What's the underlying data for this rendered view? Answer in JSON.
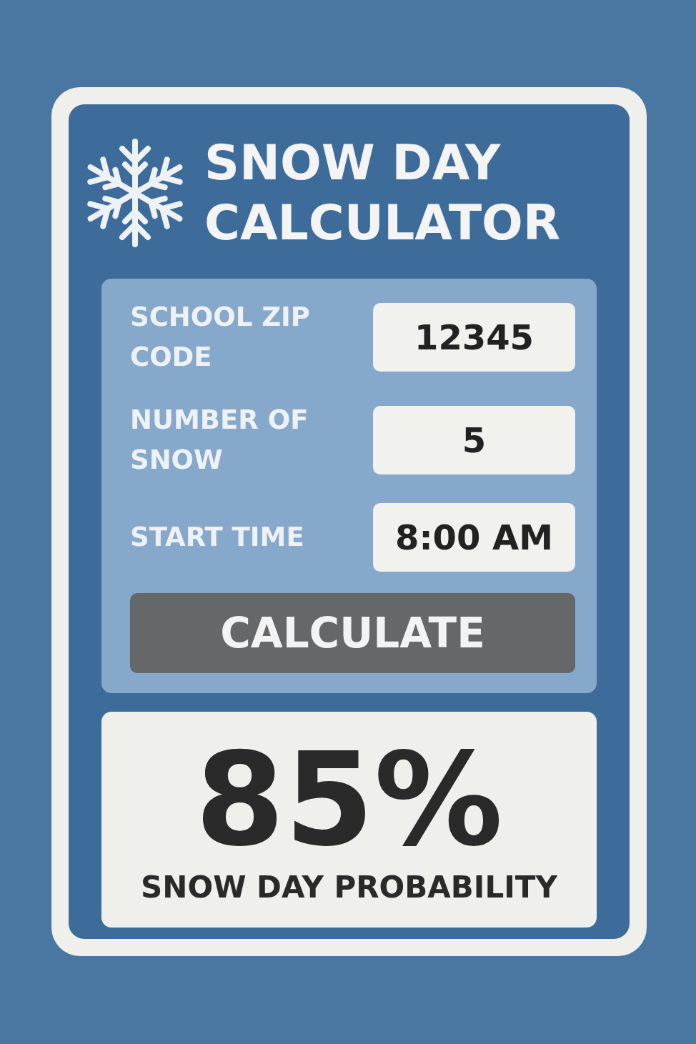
{
  "title": [
    "SNOW DAY",
    "CALCULATOR"
  ],
  "fields": [
    {
      "label": "SCHOOL ZIP CODE",
      "value": "12345"
    },
    {
      "label": "NUMBER OF SNOW",
      "value": "5"
    },
    {
      "label": "START TIME",
      "value": "8:00 AM"
    }
  ],
  "button": "CALCULATE",
  "result": {
    "value": "85%",
    "label": "SNOW DAY PROBABILITY"
  }
}
